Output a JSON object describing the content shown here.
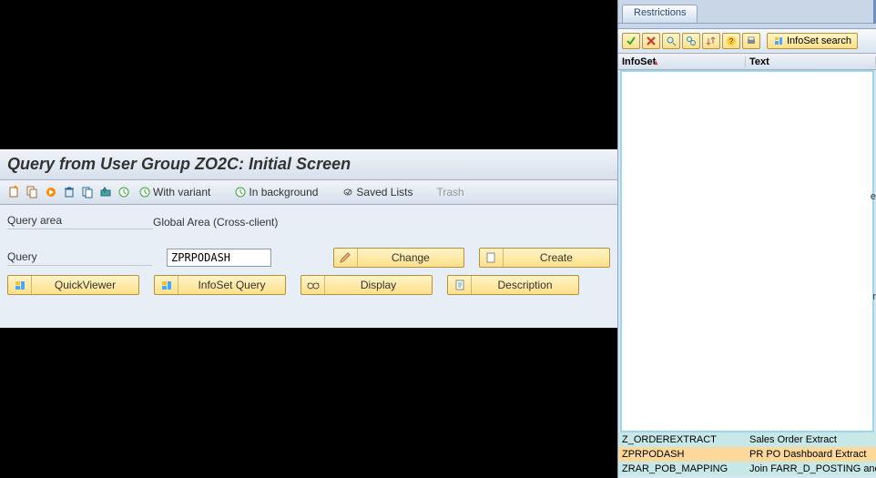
{
  "main": {
    "title": "Query from User Group ZO2C: Initial Screen",
    "toolbar": {
      "with_variant": "With variant",
      "in_background": "In background",
      "saved_lists": "Saved Lists",
      "trash": "Trash"
    },
    "query_area_label": "Query area",
    "query_area_value": "Global Area (Cross-client)",
    "query_label": "Query",
    "query_value": "ZPRPODASH",
    "buttons": {
      "change": "Change",
      "create": "Create",
      "quickviewer": "QuickViewer",
      "infoset_query": "InfoSet Query",
      "display": "Display",
      "description": "Description"
    }
  },
  "side": {
    "tab": "Restrictions",
    "infoset_search": "InfoSet search",
    "headers": {
      "infoset": "InfoSet",
      "text": "Text"
    },
    "rows": [
      {
        "id": "Z_ORDEREXTRACT",
        "text": "Sales Order Extract"
      },
      {
        "id": "ZPRPODASH",
        "text": "PR PO Dashboard Extract"
      },
      {
        "id": "ZRAR_POB_MAPPING",
        "text": "Join FARR_D_POSTING and MAPPING"
      }
    ],
    "edge_chars": {
      "e": "e",
      "r": "r"
    }
  }
}
